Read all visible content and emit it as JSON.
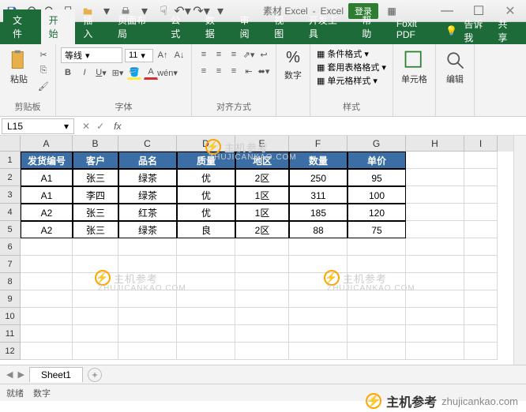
{
  "title": {
    "doc": "素材 Excel",
    "app": "Excel",
    "login": "登录"
  },
  "qat_icons": [
    "save-icon",
    "undo-icon",
    "redo-icon",
    "new-icon",
    "open-icon",
    "print-icon",
    "touch-icon",
    "undo2-icon",
    "redo2-icon"
  ],
  "tabs": {
    "file": "文件",
    "list": [
      "开始",
      "插入",
      "页面布局",
      "公式",
      "数据",
      "审阅",
      "视图",
      "开发工具",
      "帮助",
      "Foxit PDF"
    ],
    "active": 0,
    "tell": "告诉我",
    "share": "共享"
  },
  "ribbon": {
    "clipboard": {
      "label": "剪贴板",
      "paste": "粘贴"
    },
    "font": {
      "label": "字体",
      "name": "等线",
      "size": "11"
    },
    "align": {
      "label": "对齐方式"
    },
    "number": {
      "label": "数字",
      "btn": "数字"
    },
    "styles": {
      "label": "样式",
      "cond": "条件格式",
      "table": "套用表格格式",
      "cell": "单元格样式"
    },
    "cells": {
      "label": "单元格",
      "btn": "单元格"
    },
    "editing": {
      "label": "编辑",
      "btn": "编辑"
    }
  },
  "namebox": "L15",
  "sheet": {
    "name": "Sheet1"
  },
  "status": {
    "ready": "就绪",
    "mode": "数字"
  },
  "grid": {
    "cols": [
      "A",
      "B",
      "C",
      "D",
      "E",
      "F",
      "G",
      "H",
      "I"
    ],
    "widths": [
      66,
      58,
      74,
      74,
      68,
      74,
      74,
      74,
      42
    ],
    "headers": [
      "发货编号",
      "客户",
      "品名",
      "质量",
      "地区",
      "数量",
      "单价"
    ],
    "rows": [
      [
        "A1",
        "张三",
        "绿茶",
        "优",
        "2区",
        "250",
        "95"
      ],
      [
        "A1",
        "李四",
        "绿茶",
        "优",
        "1区",
        "311",
        "100"
      ],
      [
        "A2",
        "张三",
        "红茶",
        "优",
        "1区",
        "185",
        "120"
      ],
      [
        "A2",
        "张三",
        "绿茶",
        "良",
        "2区",
        "88",
        "75"
      ]
    ],
    "visible_rows": 12
  },
  "watermark": {
    "zh": "主机参考",
    "en": "ZHUJICANKAO.COM",
    "site": "zhujicankao.com"
  }
}
